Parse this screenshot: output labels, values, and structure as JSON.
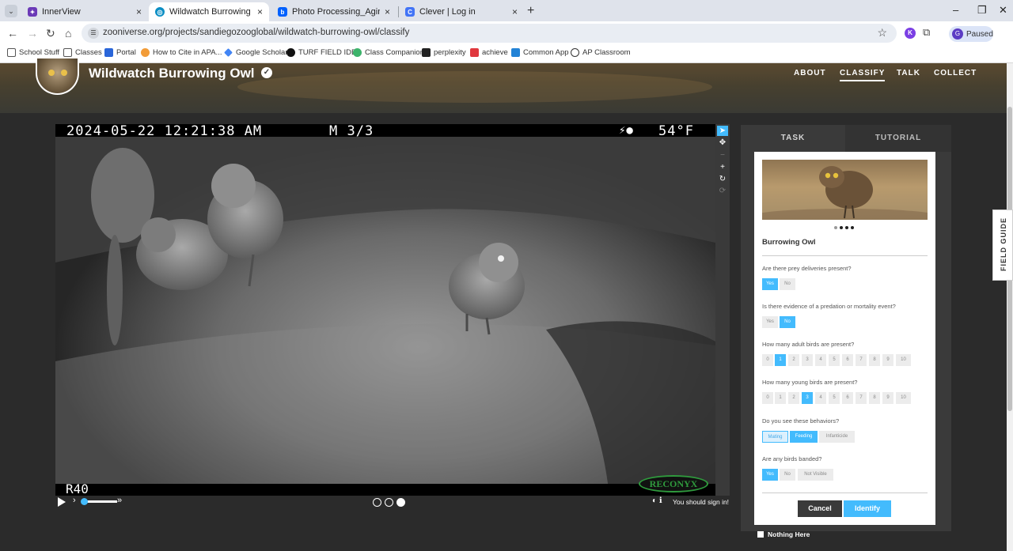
{
  "browser": {
    "tabs": [
      {
        "title": "InnerView",
        "active": false,
        "favicon_color": "#6b3ab7"
      },
      {
        "title": "Wildwatch Burrowing Owl » Cla",
        "active": true,
        "favicon_color": "#0b8ec4"
      },
      {
        "title": "Photo Processing_Aging BUOW",
        "active": false,
        "favicon_color": "#0061fe"
      },
      {
        "title": "Clever | Log in",
        "active": false,
        "favicon_color": "#4274f6"
      }
    ],
    "close_glyph": "×",
    "new_tab_glyph": "+",
    "url": "zooniverse.org/projects/sandiegozooglobal/wildwatch-burrowing-owl/classify",
    "profile_initial": "G",
    "profile_status": "Paused",
    "ext_initial": "K",
    "bookmarks": [
      {
        "label": "School Stuff",
        "icon": "folder-icon",
        "color": "#555555"
      },
      {
        "label": "Classes",
        "icon": "folder-icon",
        "color": "#555555"
      },
      {
        "label": "Portal",
        "icon": "portal-icon",
        "color": "#2a66d9"
      },
      {
        "label": "How to Cite in APA...",
        "icon": "wifi-icon",
        "color": "#f29c38"
      },
      {
        "label": "Google Scholar",
        "icon": "scholar-icon",
        "color": "#4285f4"
      },
      {
        "label": "TURF FIELD IDEA",
        "icon": "github-icon",
        "color": "#111111"
      },
      {
        "label": "Class Companion",
        "icon": "companion-icon",
        "color": "#3db36b"
      },
      {
        "label": "perplexity",
        "icon": "perplexity-icon",
        "color": "#222222"
      },
      {
        "label": "achieve",
        "icon": "achieve-icon",
        "color": "#e0383e"
      },
      {
        "label": "Common App",
        "icon": "commonapp-icon",
        "color": "#2383d6"
      },
      {
        "label": "AP Classroom",
        "icon": "apclassroom-icon",
        "color": "#333333"
      }
    ]
  },
  "project": {
    "title": "Wildwatch Burrowing Owl",
    "nav": [
      "ABOUT",
      "CLASSIFY",
      "TALK",
      "COLLECT"
    ],
    "active_nav": "CLASSIFY"
  },
  "viewer": {
    "timestamp": "2024-05-22 12:21:38 AM",
    "sequence": "M 3/3",
    "moon_icon": "moon-phase-icon",
    "temperature": "54°F",
    "camera_id": "R40",
    "camera_brand": "RECONYX",
    "frames": 3,
    "current_frame": 3,
    "sign_in_text": "You should sign in!"
  },
  "task_panel": {
    "tabs": [
      "TASK",
      "TUTORIAL"
    ],
    "guide_title": "Burrowing Owl",
    "questions": [
      {
        "text": "Are there prey deliveries present?",
        "options": [
          "Yes",
          "No"
        ],
        "selected": [
          "Yes"
        ]
      },
      {
        "text": "Is there evidence of a predation or mortality event?",
        "options": [
          "Yes",
          "No"
        ],
        "selected": [
          "No"
        ]
      },
      {
        "text": "How many adult birds are present?",
        "options": [
          "0",
          "1",
          "2",
          "3",
          "4",
          "5",
          "6",
          "7",
          "8",
          "9",
          "10"
        ],
        "selected": [
          "1"
        ]
      },
      {
        "text": "How many young birds are present?",
        "options": [
          "0",
          "1",
          "2",
          "3",
          "4",
          "5",
          "6",
          "7",
          "8",
          "9",
          "10"
        ],
        "selected": [
          "3"
        ]
      },
      {
        "text": "Do you see these behaviors?",
        "options": [
          "Mating",
          "Feeding",
          "Infanticide"
        ],
        "selected": [
          "Feeding"
        ],
        "light": [
          "Mating"
        ]
      },
      {
        "text": "Are any birds banded?",
        "options": [
          "Yes",
          "No",
          "Not Visible"
        ],
        "selected": [
          "Yes"
        ]
      }
    ],
    "cancel_label": "Cancel",
    "identify_label": "Identify",
    "nothing_here_label": "Nothing Here"
  },
  "field_guide_label": "FIELD GUIDE",
  "colors": {
    "accent": "#43bbfd",
    "panel_dark": "#3a3a3a",
    "page_bg": "#2b2b2b"
  }
}
